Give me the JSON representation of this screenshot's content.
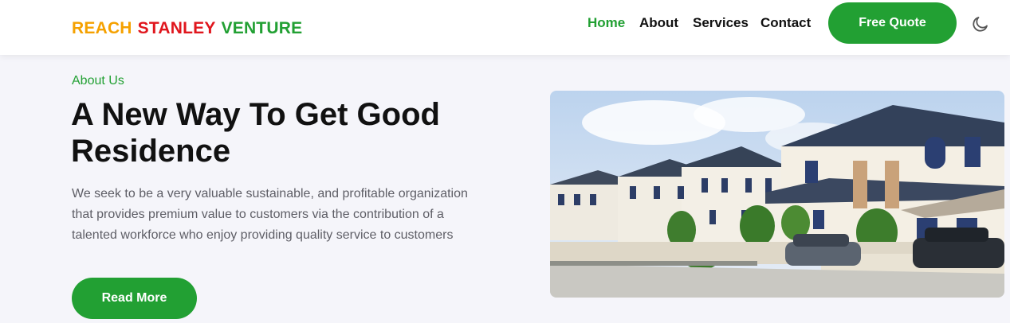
{
  "brand": {
    "words": [
      "REACH",
      "STANLEY",
      "VENTURE"
    ],
    "colors": [
      "#f5a100",
      "#e0161d",
      "#22a033"
    ]
  },
  "nav": {
    "home": "Home",
    "about": "About",
    "services": "Services",
    "contact": "Contact",
    "active_color": "#22a033"
  },
  "header": {
    "cta_label": "Free Quote",
    "theme_icon": "moon-icon"
  },
  "hero": {
    "eyebrow": "About Us",
    "title": "A New Way To Get Good Residence",
    "description": "We seek to be a very valuable sustainable, and profitable organization that provides premium value to customers via the contribution of a talented workforce who enjoy providing quality service to customers",
    "button_label": "Read More",
    "image_icon": "residential-houses-photo"
  },
  "colors": {
    "accent": "#22a033",
    "background": "#f5f5fa",
    "text": "#111111",
    "muted_text": "#5e5e66"
  }
}
